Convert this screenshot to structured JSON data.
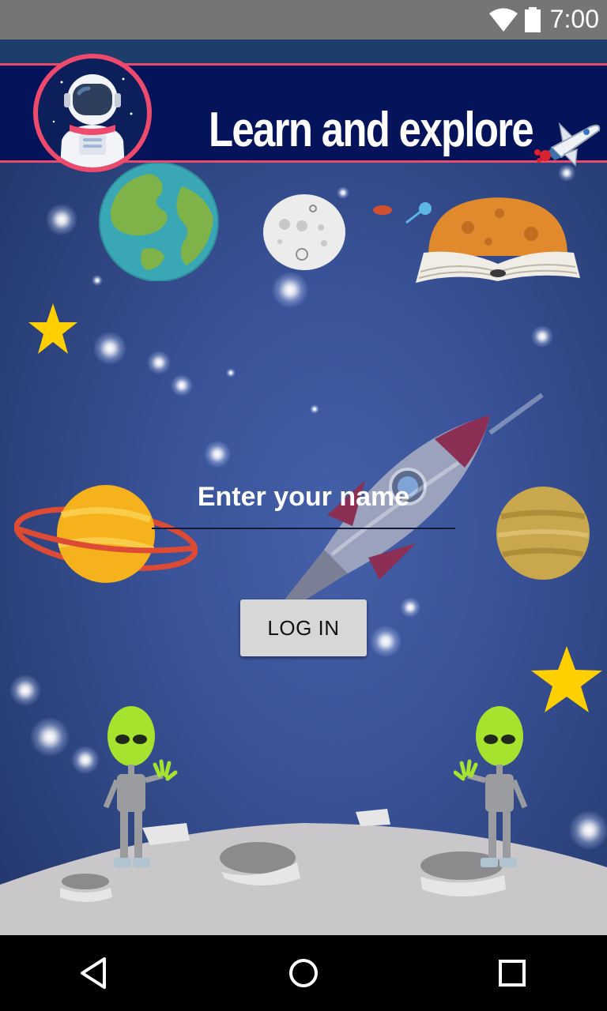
{
  "status_bar": {
    "time": "7:00",
    "wifi_icon": "wifi-icon",
    "battery_icon": "battery-icon"
  },
  "header": {
    "title": "Learn and explore",
    "avatar_icon": "astronaut-icon",
    "decoration_icon": "space-shuttle-icon",
    "accent_color": "#e84a6c",
    "banner_color": "#04135a"
  },
  "form": {
    "name_placeholder": "Enter your name",
    "name_value": "",
    "login_label": "LOG IN"
  },
  "nav": {
    "back_icon": "back-triangle-icon",
    "home_icon": "home-circle-icon",
    "recents_icon": "recents-square-icon"
  },
  "colors": {
    "background": "#3a5399",
    "button": "#d7d7d7",
    "star": "#ffcf00"
  }
}
